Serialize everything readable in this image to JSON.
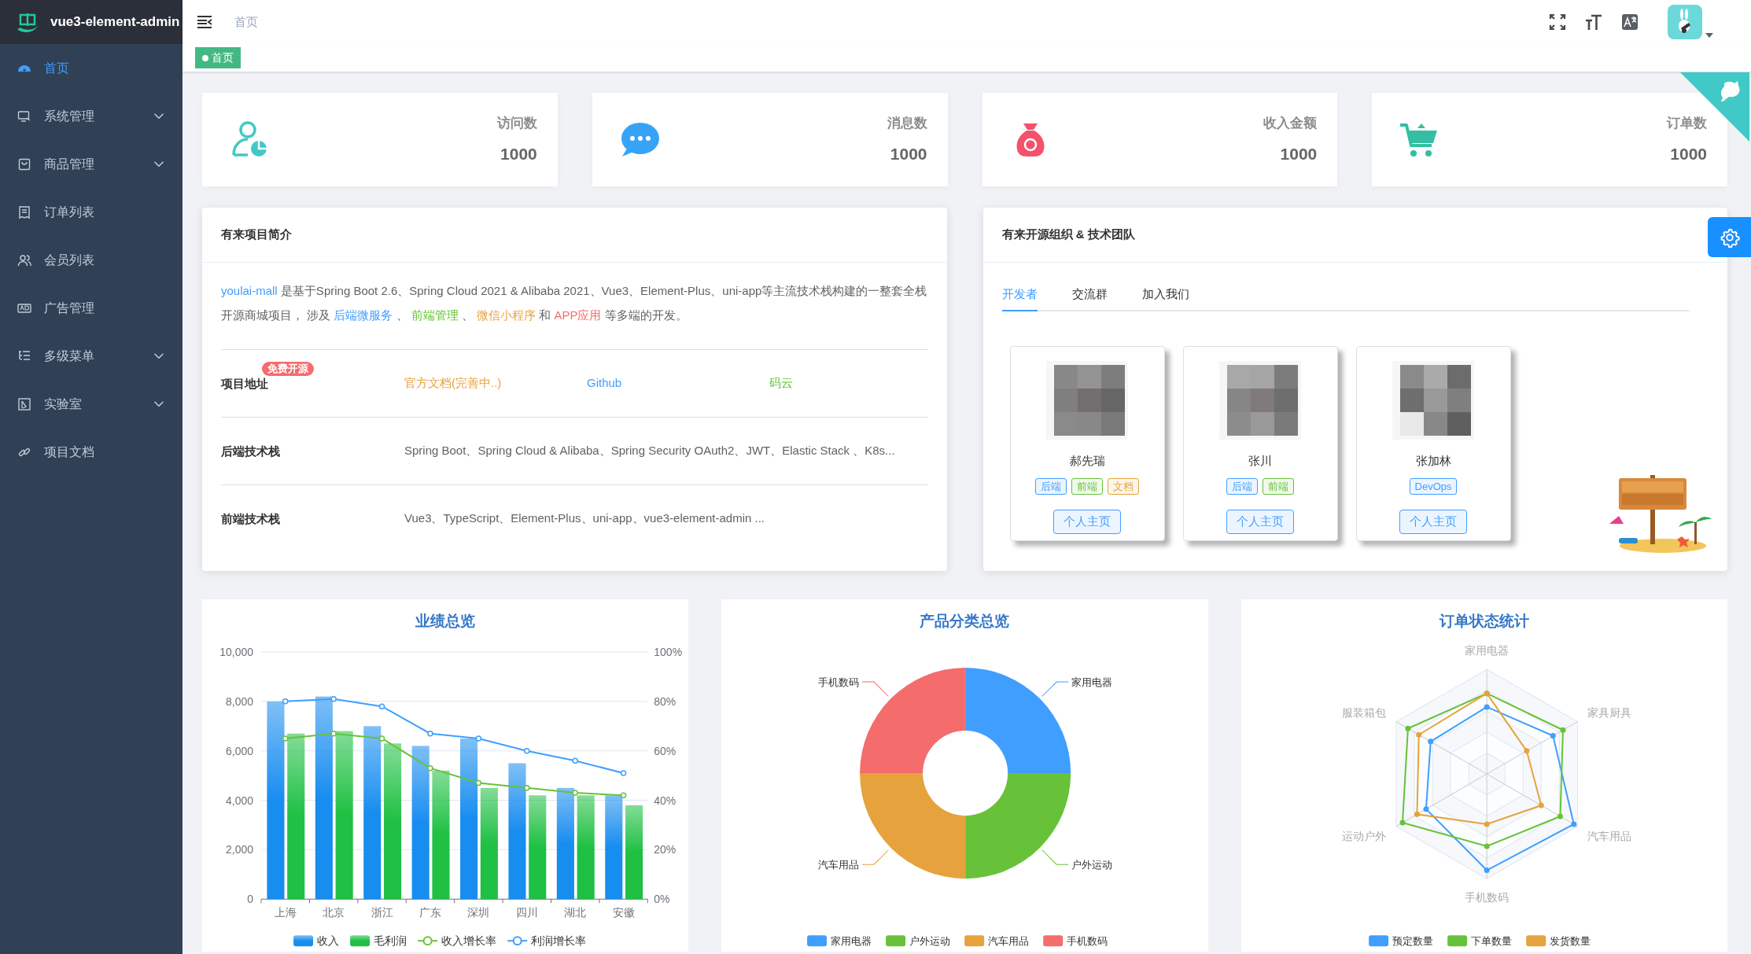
{
  "sidebar": {
    "logo_text": "vue3-element-admin",
    "items": [
      {
        "label": "首页",
        "selected": true,
        "submenu": false
      },
      {
        "label": "系统管理",
        "selected": false,
        "submenu": true
      },
      {
        "label": "商品管理",
        "selected": false,
        "submenu": true
      },
      {
        "label": "订单列表",
        "selected": false,
        "submenu": false
      },
      {
        "label": "会员列表",
        "selected": false,
        "submenu": false
      },
      {
        "label": "广告管理",
        "selected": false,
        "submenu": false
      },
      {
        "label": "多级菜单",
        "selected": false,
        "submenu": true
      },
      {
        "label": "实验室",
        "selected": false,
        "submenu": true
      },
      {
        "label": "项目文档",
        "selected": false,
        "submenu": false
      }
    ]
  },
  "header": {
    "breadcrumb": "首页"
  },
  "tags": [
    {
      "label": "首页",
      "selected": true
    }
  ],
  "stats": [
    {
      "label": "访问数",
      "value": "1000"
    },
    {
      "label": "消息数",
      "value": "1000"
    },
    {
      "label": "收入金额",
      "value": "1000"
    },
    {
      "label": "订单数",
      "value": "1000"
    }
  ],
  "intro_panel": {
    "title": "有来项目简介",
    "paragraph": [
      {
        "kind": "link",
        "text": "youlai-mall",
        "color": "#409eff"
      },
      {
        "kind": "text",
        "text": " 是基于Spring Boot 2.6、Spring Cloud 2021 & Alibaba 2021、Vue3、Element-Plus、uni-app等主流技术栈构建的一整套全栈开源商城项目， 涉及 "
      },
      {
        "kind": "link",
        "text": "后端微服务",
        "color": "#409eff"
      },
      {
        "kind": "text",
        "text": " 、 "
      },
      {
        "kind": "link",
        "text": "前端管理",
        "color": "#67c23a"
      },
      {
        "kind": "text",
        "text": " 、 "
      },
      {
        "kind": "link",
        "text": "微信小程序",
        "color": "#e6a23c"
      },
      {
        "kind": "text",
        "text": " 和 "
      },
      {
        "kind": "link",
        "text": "APP应用",
        "color": "#f56c6c"
      },
      {
        "kind": "text",
        "text": " 等多端的开发。"
      }
    ],
    "rows": [
      {
        "kind": "links",
        "label": "项目地址",
        "badge": "免费开源",
        "links": [
          {
            "text": "官方文档(完善中..)",
            "color": "#e6a23c"
          },
          {
            "text": "Github",
            "color": "#409eff"
          },
          {
            "text": "码云",
            "color": "#67c23a"
          }
        ]
      },
      {
        "kind": "text",
        "label": "后端技术栈",
        "text": "Spring Boot、Spring Cloud & Alibaba、Spring Security OAuth2、JWT、Elastic Stack 、K8s..."
      },
      {
        "kind": "text",
        "label": "前端技术栈",
        "text": "Vue3、TypeScript、Element-Plus、uni-app、vue3-element-admin ..."
      }
    ]
  },
  "team_panel": {
    "title": "有来开源组织 & 技术团队",
    "tabs": [
      {
        "label": "开发者",
        "selected": true
      },
      {
        "label": "交流群",
        "selected": false
      },
      {
        "label": "加入我们",
        "selected": false
      }
    ],
    "members": [
      {
        "name": "郝先瑞",
        "tags": [
          {
            "label": "后端",
            "color": "#409eff"
          },
          {
            "label": "前端",
            "color": "#67c23a"
          },
          {
            "label": "文档",
            "color": "#e6a23c"
          }
        ],
        "button": "个人主页"
      },
      {
        "name": "张川",
        "tags": [
          {
            "label": "后端",
            "color": "#409eff"
          },
          {
            "label": "前端",
            "color": "#67c23a"
          }
        ],
        "button": "个人主页"
      },
      {
        "name": "张加林",
        "tags": [
          {
            "label": "DevOps",
            "color": "#409eff"
          }
        ],
        "button": "个人主页"
      }
    ]
  },
  "charts": [
    {
      "kind": "chart",
      "chart_data": {
        "type": "bar",
        "legend": "bottom",
        "stacked": false,
        "grid": true,
        "title": "业绩总览",
        "categories": [
          "上海",
          "北京",
          "浙江",
          "广东",
          "深圳",
          "四川",
          "湖北",
          "安徽"
        ],
        "series": [
          {
            "name": "收入",
            "type": "bar",
            "color": "#188df0",
            "values": [
              8000,
              8200,
              7000,
              6200,
              6500,
              5500,
              4500,
              4200
            ]
          },
          {
            "name": "毛利润",
            "type": "bar",
            "color": "#1fc043",
            "values": [
              6700,
              6800,
              6300,
              5200,
              4500,
              4200,
              4200,
              3800
            ]
          },
          {
            "name": "收入增长率",
            "type": "line",
            "axis": "y2",
            "marker": "circle",
            "color": "#67c23a",
            "values": [
              65,
              67,
              65,
              53,
              47,
              45,
              43,
              42
            ]
          },
          {
            "name": "利润增长率",
            "type": "line",
            "axis": "y2",
            "marker": "circle",
            "color": "#409eff",
            "values": [
              80,
              81,
              78,
              67,
              65,
              60,
              56,
              51
            ]
          }
        ],
        "ylim": [
          0,
          10000
        ],
        "y2lim": [
          0,
          100
        ],
        "yticks": [
          {
            "value": 0,
            "label": "0"
          },
          {
            "value": 2000,
            "label": "2,000"
          },
          {
            "value": 4000,
            "label": "4,000"
          },
          {
            "value": 6000,
            "label": "6,000"
          },
          {
            "value": 8000,
            "label": "8,000"
          },
          {
            "value": 10000,
            "label": "10,000"
          }
        ],
        "y2ticks": [
          {
            "value": 0,
            "label": "0%"
          },
          {
            "value": 20,
            "label": "20%"
          },
          {
            "value": 40,
            "label": "40%"
          },
          {
            "value": 60,
            "label": "60%"
          },
          {
            "value": 80,
            "label": "80%"
          },
          {
            "value": 100,
            "label": "100%"
          }
        ]
      }
    },
    {
      "kind": "chart",
      "chart_data": {
        "type": "donut",
        "legend": "bottom",
        "title": "产品分类总览",
        "categories": [
          "家用电器",
          "户外运动",
          "汽车用品",
          "手机数码"
        ],
        "values": [
          25,
          25,
          25,
          25
        ],
        "colors": [
          "#409eff",
          "#67c23a",
          "#e6a23c",
          "#f56c6c"
        ]
      }
    },
    {
      "kind": "radar",
      "title": "订单状态统计",
      "axes": [
        "家用电器",
        "家具厨具",
        "汽车用品",
        "手机数码",
        "运动户外",
        "服装箱包"
      ],
      "legend": [
        {
          "name": "预定数量",
          "color": "#409eff"
        },
        {
          "name": "下单数量",
          "color": "#67c23a"
        },
        {
          "name": "发货数量",
          "color": "#e6a23c"
        }
      ]
    }
  ]
}
